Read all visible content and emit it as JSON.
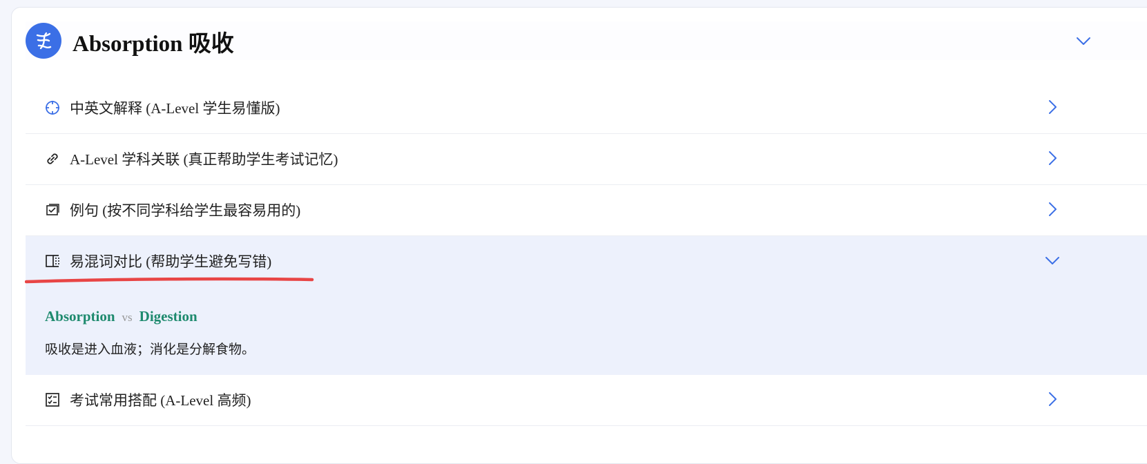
{
  "header": {
    "title": "Absorption 吸收",
    "logo_icon": "dna-icon",
    "accent": "#3b6fe6"
  },
  "sections": [
    {
      "label": "中英文解释 (A-Level 学生易懂版)",
      "icon": "crosshair-icon",
      "expanded": false
    },
    {
      "label": "A-Level 学科关联 (真正帮助学生考试记忆)",
      "icon": "link-icon",
      "expanded": false
    },
    {
      "label": "例句 (按不同学科给学生最容易用的)",
      "icon": "checklist-box-icon",
      "expanded": false
    },
    {
      "label": "易混词对比 (帮助学生避免写错)",
      "icon": "compare-columns-icon",
      "expanded": true
    },
    {
      "label": "考试常用搭配 (A-Level 高频)",
      "icon": "checklist-icon",
      "expanded": false
    }
  ],
  "comparison": {
    "term_a": "Absorption",
    "vs": "vs",
    "term_b": "Digestion",
    "description": "吸收是进入血液；消化是分解食物。",
    "term_color": "#1e8a6e"
  },
  "annotation_color": "#e84545"
}
